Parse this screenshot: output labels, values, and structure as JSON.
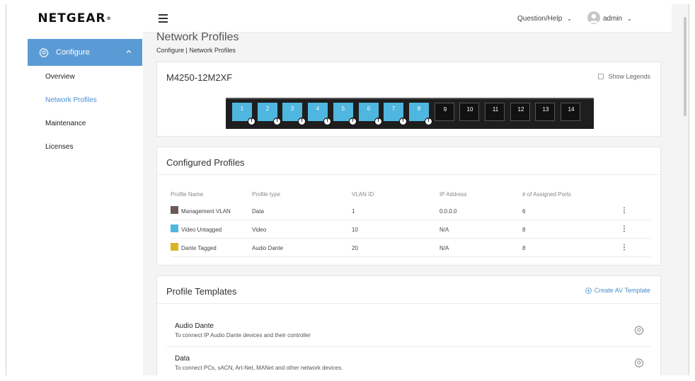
{
  "brand": {
    "logo_text": "NETGEAR",
    "logo_mark": "®"
  },
  "sidebar": {
    "configure_label": "Configure",
    "items": [
      {
        "label": "Overview",
        "active": false
      },
      {
        "label": "Network Profiles",
        "active": true
      },
      {
        "label": "Maintenance",
        "active": false
      },
      {
        "label": "Licenses",
        "active": false
      }
    ]
  },
  "topbar": {
    "help_label": "Question/Help",
    "user_label": "admin"
  },
  "page": {
    "title": "Network Profiles",
    "breadcrumb": "Configure | Network Profiles"
  },
  "device": {
    "model": "M4250-12M2XF",
    "show_legends_label": "Show Legends",
    "ports": [
      {
        "num": "1",
        "color": "#4fb6e0",
        "tagged": true
      },
      {
        "num": "2",
        "color": "#4fb6e0",
        "tagged": true
      },
      {
        "num": "3",
        "color": "#4fb6e0",
        "tagged": true
      },
      {
        "num": "4",
        "color": "#4fb6e0",
        "tagged": true
      },
      {
        "num": "5",
        "color": "#4fb6e0",
        "tagged": true
      },
      {
        "num": "6",
        "color": "#4fb6e0",
        "tagged": true
      },
      {
        "num": "7",
        "color": "#4fb6e0",
        "tagged": true
      },
      {
        "num": "8",
        "color": "#4fb6e0",
        "tagged": true
      },
      {
        "num": "9",
        "color": "#111111",
        "tagged": false
      },
      {
        "num": "10",
        "color": "#111111",
        "tagged": false
      },
      {
        "num": "11",
        "color": "#111111",
        "tagged": false
      },
      {
        "num": "12",
        "color": "#111111",
        "tagged": false
      },
      {
        "num": "13",
        "color": "#111111",
        "tagged": false
      },
      {
        "num": "14",
        "color": "#111111",
        "tagged": false
      }
    ],
    "tag_letter": "T"
  },
  "profiles": {
    "title": "Configured Profiles",
    "headers": [
      "Profile Name",
      "Profile type",
      "VLAN ID",
      "IP Address",
      "# of Assigned Ports"
    ],
    "rows": [
      {
        "name": "Management VLAN",
        "color": "#6b5a55",
        "type": "Data",
        "vlan": "1",
        "ip": "0.0.0.0",
        "ports": "6"
      },
      {
        "name": "Video Untagged",
        "color": "#4fb6e0",
        "type": "Video",
        "vlan": "10",
        "ip": "N/A",
        "ports": "8"
      },
      {
        "name": "Dante Tagged",
        "color": "#d9b526",
        "type": "Audio Dante",
        "vlan": "20",
        "ip": "N/A",
        "ports": "8"
      }
    ]
  },
  "templates": {
    "title": "Profile Templates",
    "create_label": "Create AV Template",
    "items": [
      {
        "title": "Audio Dante",
        "desc": "To connect IP Audio Dante devices and their controller"
      },
      {
        "title": "Data",
        "desc": "To connect PCs, sACN, Art-Net, MANet and other network devices."
      }
    ]
  },
  "colors": {
    "accent": "#5b9bd5",
    "link": "#4a8fd0",
    "port_blue": "#4fb6e0"
  }
}
